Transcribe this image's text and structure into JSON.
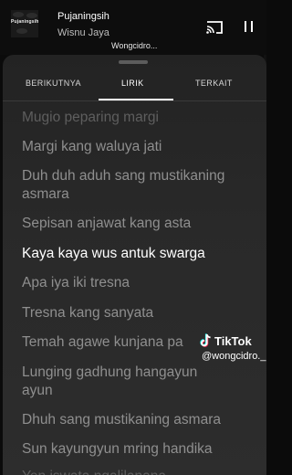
{
  "player": {
    "album_art_text": "Pujaningsih",
    "song_title": "Pujaningsih",
    "artist": "Wisnu Jaya",
    "cast_icon": "cast-icon",
    "pause_icon": "pause-icon"
  },
  "watermark_top": "Wongcidro...",
  "tabs": [
    {
      "label": "BERIKUTNYA",
      "active": false
    },
    {
      "label": "LIRIK",
      "active": true
    },
    {
      "label": "TERKAIT",
      "active": false
    }
  ],
  "lyrics": [
    {
      "text": "Mugio peparing margi",
      "state": "dim"
    },
    {
      "text": "Margi kang waluya jati",
      "state": "normal"
    },
    {
      "text": "Duh duh aduh sang mustikaning",
      "state": "normal"
    },
    {
      "text": "asmara",
      "state": "normal"
    },
    {
      "text": "Sepisan anjawat kang asta",
      "state": "normal"
    },
    {
      "text": "Kaya kaya wus antuk swarga",
      "state": "active"
    },
    {
      "text": "Apa iya iki tresna",
      "state": "normal"
    },
    {
      "text": "Tresna kang sanyata",
      "state": "normal"
    },
    {
      "text": "Temah agawe kunjana pa",
      "state": "normal"
    },
    {
      "text": "Lunging gadhung hangayun",
      "state": "normal"
    },
    {
      "text": "ayun",
      "state": "normal"
    },
    {
      "text": "Dhuh sang mustikaning asmara",
      "state": "normal"
    },
    {
      "text": "Sun kayungyun mring handika",
      "state": "normal"
    },
    {
      "text": "Yen iswata ngalilanana",
      "state": "dim"
    }
  ],
  "tiktok": {
    "logo_icon": "tiktok-logo-icon",
    "name": "TikTok",
    "handle": "@wongcidro._"
  },
  "colors": {
    "sheet_bg": "#2a2a2a",
    "active_lyric": "#ffffff",
    "lyric": "#8f8f8f",
    "tiktok_cyan": "#25f4ee",
    "tiktok_red": "#fe2c55"
  }
}
